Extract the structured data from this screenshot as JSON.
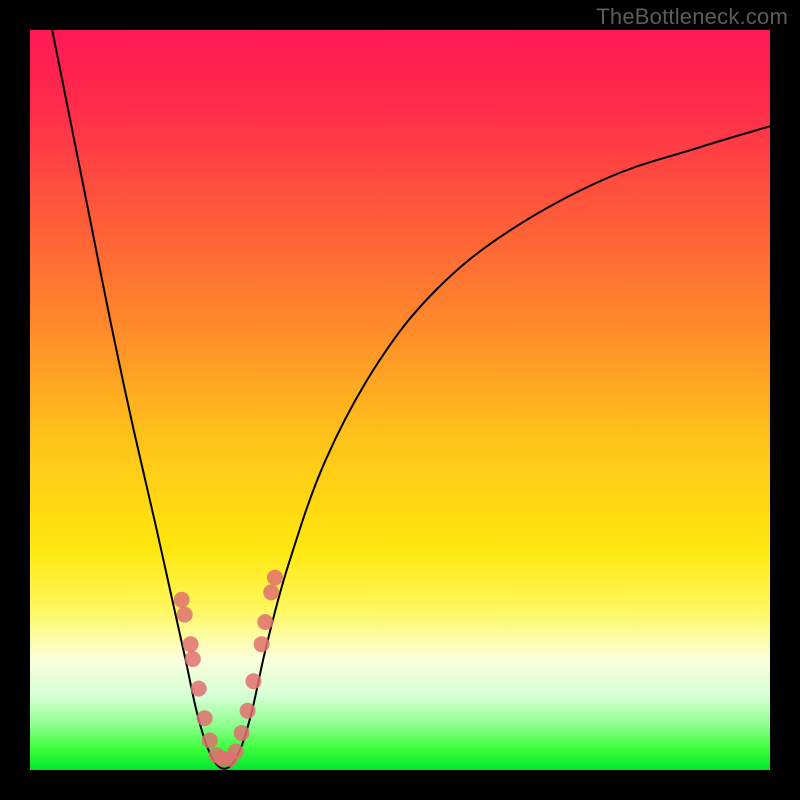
{
  "watermark": "TheBottleneck.com",
  "chart_data": {
    "type": "line",
    "title": "",
    "xlabel": "",
    "ylabel": "",
    "xlim": [
      0,
      100
    ],
    "ylim": [
      0,
      100
    ],
    "background_gradient": {
      "stops": [
        {
          "offset": 0.0,
          "color": "#ff1a55"
        },
        {
          "offset": 0.1,
          "color": "#ff2b4b"
        },
        {
          "offset": 0.25,
          "color": "#ff5a3a"
        },
        {
          "offset": 0.4,
          "color": "#ff8a2a"
        },
        {
          "offset": 0.55,
          "color": "#ffc21a"
        },
        {
          "offset": 0.7,
          "color": "#ffe70f"
        },
        {
          "offset": 0.78,
          "color": "#fff75a"
        },
        {
          "offset": 0.85,
          "color": "#fbffdc"
        },
        {
          "offset": 0.9,
          "color": "#d6ffd6"
        },
        {
          "offset": 0.94,
          "color": "#8cff8c"
        },
        {
          "offset": 0.97,
          "color": "#3dff3d"
        },
        {
          "offset": 1.0,
          "color": "#00e62e"
        }
      ]
    },
    "series": [
      {
        "name": "bottleneck-curve",
        "color": "#000000",
        "stroke_width": 2,
        "points": [
          {
            "x": 3.0,
            "y": 100.0
          },
          {
            "x": 5.0,
            "y": 90.0
          },
          {
            "x": 8.0,
            "y": 75.0
          },
          {
            "x": 11.0,
            "y": 60.0
          },
          {
            "x": 14.0,
            "y": 46.0
          },
          {
            "x": 17.0,
            "y": 33.0
          },
          {
            "x": 19.0,
            "y": 24.0
          },
          {
            "x": 21.0,
            "y": 15.0
          },
          {
            "x": 22.5,
            "y": 8.0
          },
          {
            "x": 24.0,
            "y": 3.0
          },
          {
            "x": 25.5,
            "y": 0.5
          },
          {
            "x": 27.0,
            "y": 0.5
          },
          {
            "x": 28.5,
            "y": 3.0
          },
          {
            "x": 30.0,
            "y": 8.0
          },
          {
            "x": 32.0,
            "y": 17.0
          },
          {
            "x": 35.0,
            "y": 28.0
          },
          {
            "x": 40.0,
            "y": 42.0
          },
          {
            "x": 47.0,
            "y": 55.0
          },
          {
            "x": 55.0,
            "y": 65.0
          },
          {
            "x": 65.0,
            "y": 73.0
          },
          {
            "x": 78.0,
            "y": 80.0
          },
          {
            "x": 90.0,
            "y": 84.0
          },
          {
            "x": 100.0,
            "y": 87.0
          }
        ]
      },
      {
        "name": "marker-dots",
        "color": "#e07070",
        "type": "scatter",
        "marker_radius": 8,
        "points": [
          {
            "x": 20.5,
            "y": 23.0
          },
          {
            "x": 20.9,
            "y": 21.0
          },
          {
            "x": 21.7,
            "y": 17.0
          },
          {
            "x": 22.0,
            "y": 15.0
          },
          {
            "x": 22.8,
            "y": 11.0
          },
          {
            "x": 23.6,
            "y": 7.0
          },
          {
            "x": 24.3,
            "y": 4.0
          },
          {
            "x": 25.2,
            "y": 2.0
          },
          {
            "x": 26.0,
            "y": 1.5
          },
          {
            "x": 27.0,
            "y": 1.5
          },
          {
            "x": 27.8,
            "y": 2.5
          },
          {
            "x": 28.6,
            "y": 5.0
          },
          {
            "x": 29.4,
            "y": 8.0
          },
          {
            "x": 30.2,
            "y": 12.0
          },
          {
            "x": 31.3,
            "y": 17.0
          },
          {
            "x": 31.8,
            "y": 20.0
          },
          {
            "x": 32.6,
            "y": 24.0
          },
          {
            "x": 33.1,
            "y": 26.0
          }
        ]
      }
    ]
  }
}
